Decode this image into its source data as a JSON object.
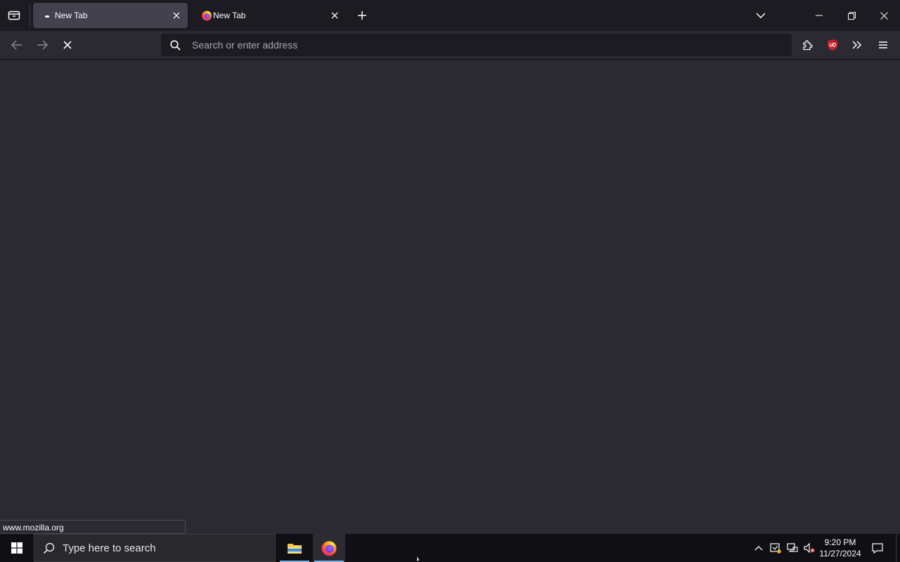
{
  "browser": {
    "tabs": [
      {
        "label": "New Tab",
        "active": true,
        "loading": true
      },
      {
        "label": "New Tab",
        "active": false,
        "loading": false
      }
    ],
    "urlbar": {
      "placeholder": "Search or enter address",
      "value": ""
    },
    "status_url": "www.mozilla.org",
    "colors": {
      "chrome_dark": "#1c1b22",
      "toolbar": "#2b2a33",
      "active_tab": "#42414d",
      "ublock_red": "#c5212a"
    },
    "icons": {
      "tab_manager": "firefox-view-icon",
      "back": "back-arrow-icon",
      "forward": "forward-arrow-icon",
      "stop": "stop-icon",
      "search": "search-icon",
      "extensions": "puzzle-icon",
      "ublock": "ublock-origin-icon",
      "overflow": "chevron-double-right-icon",
      "menu": "hamburger-menu-icon"
    }
  },
  "taskbar": {
    "search_placeholder": "Type here to search",
    "time": "9:20 PM",
    "date": "11/27/2024",
    "apps": [
      "file-explorer",
      "firefox"
    ]
  }
}
